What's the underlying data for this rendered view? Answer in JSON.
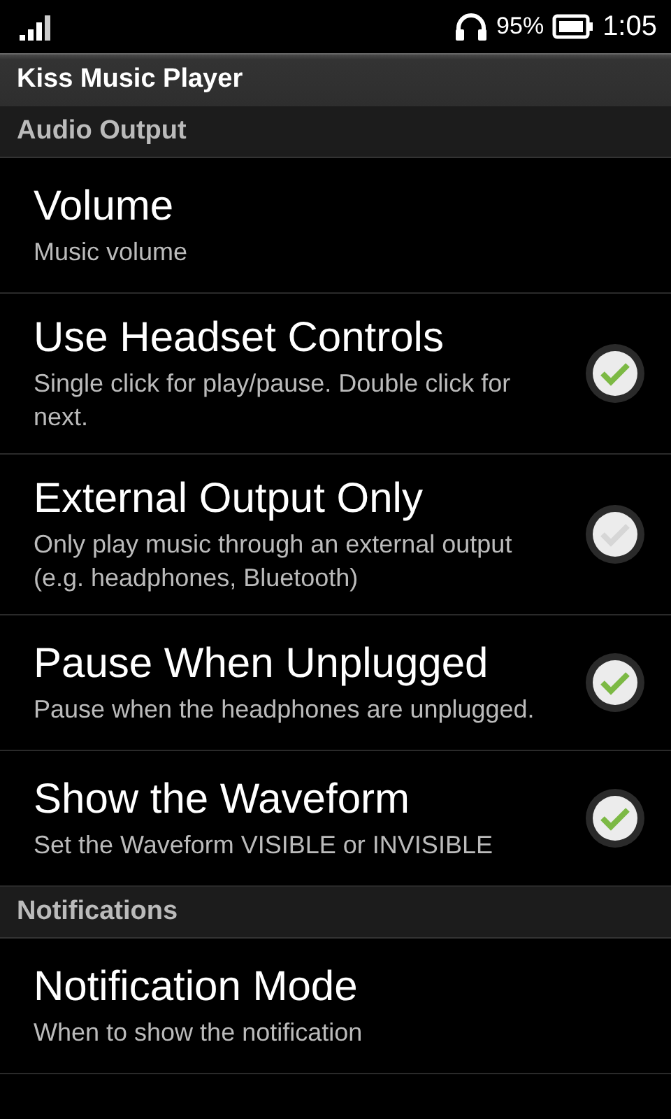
{
  "status_bar": {
    "battery": "95%",
    "time": "1:05"
  },
  "title": "Kiss Music Player",
  "sections": [
    {
      "title": "Audio Output",
      "items": [
        {
          "kind": "plain",
          "title": "Volume",
          "summary": "Music volume"
        },
        {
          "kind": "checkbox",
          "title": "Use Headset Controls",
          "summary": "Single click for play/pause. Double click for next.",
          "checked": true
        },
        {
          "kind": "checkbox",
          "title": "External Output Only",
          "summary": "Only play music through an external output (e.g. headphones, Bluetooth)",
          "checked": false
        },
        {
          "kind": "checkbox",
          "title": "Pause When Unplugged",
          "summary": "Pause when the headphones are unplugged.",
          "checked": true
        },
        {
          "kind": "checkbox",
          "title": "Show the Waveform",
          "summary": "Set the Waveform VISIBLE or INVISIBLE",
          "checked": true
        }
      ]
    },
    {
      "title": "Notifications",
      "items": [
        {
          "kind": "plain",
          "title": "Notification Mode",
          "summary": "When to show the notification"
        }
      ]
    }
  ]
}
